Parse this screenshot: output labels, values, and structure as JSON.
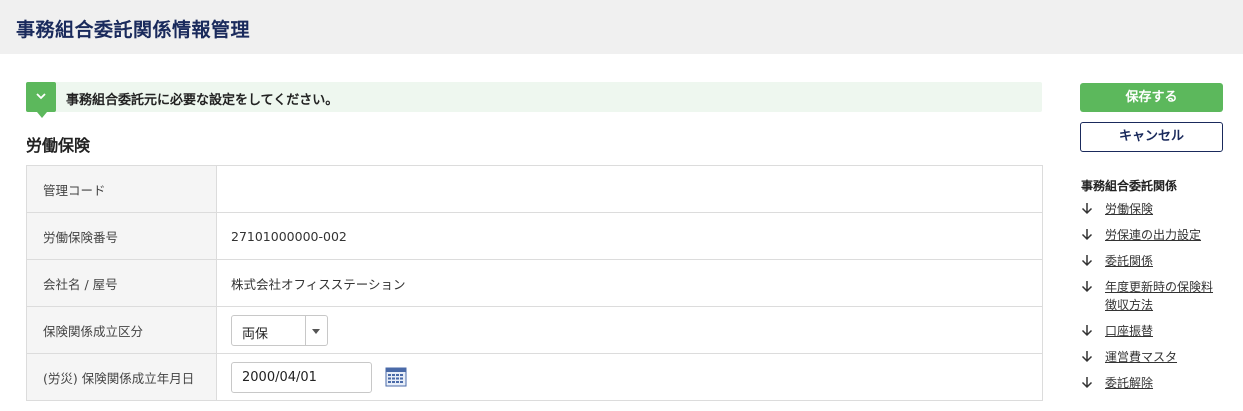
{
  "header": {
    "title": "事務組合委託関係情報管理"
  },
  "notice": {
    "text": "事務組合委託元に必要な設定をしてください。",
    "toggle_icon": "chevron-down-icon"
  },
  "section": {
    "title": "労働保険"
  },
  "form": {
    "rows": [
      {
        "label": "管理コード",
        "value": ""
      },
      {
        "label": "労働保険番号",
        "value": "27101000000-002"
      },
      {
        "label": "会社名 / 屋号",
        "value": "株式会社オフィスステーション"
      },
      {
        "label": "保険関係成立区分",
        "select_value": "両保"
      },
      {
        "label": "(労災) 保険関係成立年月日",
        "date_value": "2000/04/01"
      }
    ]
  },
  "actions": {
    "save_label": "保存する",
    "cancel_label": "キャンセル"
  },
  "side_nav": {
    "title": "事務組合委託関係",
    "items": [
      {
        "label": "労働保険"
      },
      {
        "label": "労保連の出力設定"
      },
      {
        "label": "委託関係"
      },
      {
        "label": "年度更新時の保険料徴収方法"
      },
      {
        "label": "口座振替"
      },
      {
        "label": "運営費マスタ"
      },
      {
        "label": "委託解除"
      }
    ]
  },
  "colors": {
    "accent_green": "#5cb85c",
    "navy": "#1a2a5c",
    "notice_bg": "#eef7ef"
  }
}
